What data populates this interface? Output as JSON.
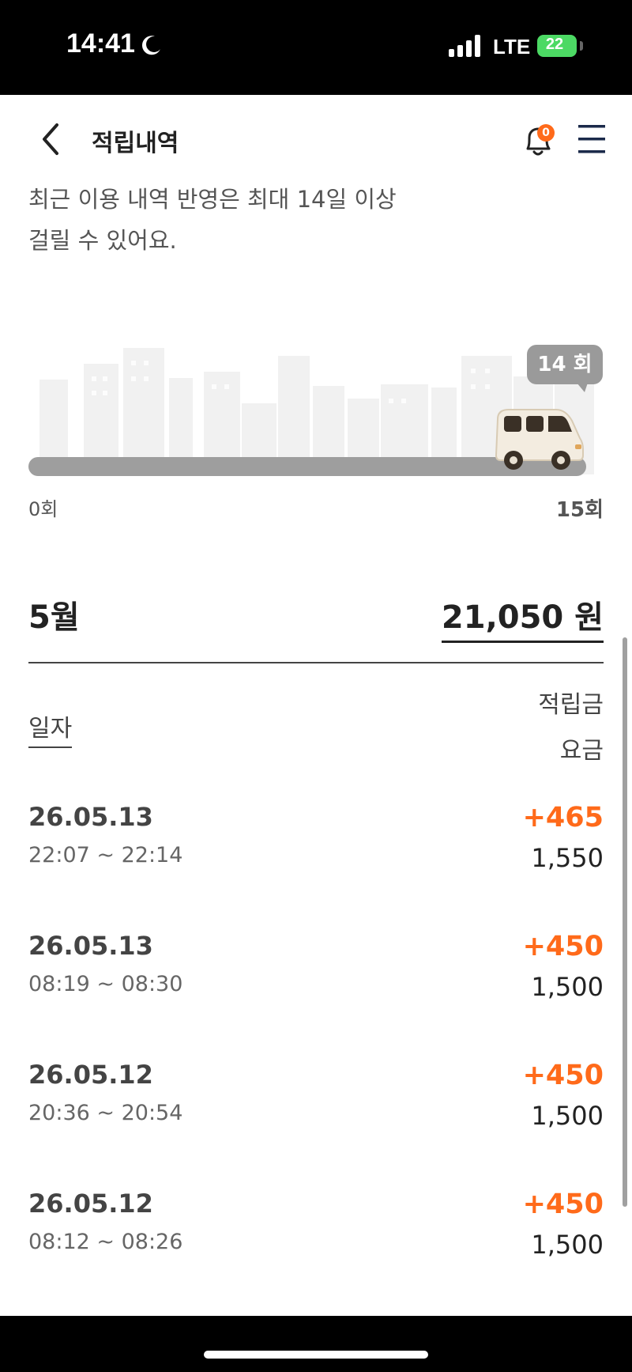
{
  "status_bar": {
    "time": "14:41",
    "network": "LTE",
    "battery": "22"
  },
  "header": {
    "title": "적립내역",
    "notification_count": "0"
  },
  "notice": {
    "line1": "최근 이용 내역 반영은 최대 14일 이상",
    "line2": "걸릴 수 있어요."
  },
  "progress": {
    "current_label": "14 회",
    "current": 14,
    "max": 15,
    "min_label": "0회",
    "max_label": "15회"
  },
  "summary": {
    "month": "5월",
    "total": "21,050 원"
  },
  "columns": {
    "date": "일자",
    "reward": "적립금",
    "fare": "요금"
  },
  "history": [
    {
      "date": "26.05.13",
      "time": "22:07 ~ 22:14",
      "reward": "+465",
      "fare": "1,550"
    },
    {
      "date": "26.05.13",
      "time": "08:19 ~ 08:30",
      "reward": "+450",
      "fare": "1,500"
    },
    {
      "date": "26.05.12",
      "time": "20:36 ~ 20:54",
      "reward": "+450",
      "fare": "1,500"
    },
    {
      "date": "26.05.12",
      "time": "08:12 ~ 08:26",
      "reward": "+450",
      "fare": "1,500"
    }
  ],
  "colors": {
    "accent": "#ff6a1a",
    "track": "#9e9e9e",
    "text": "#222222"
  },
  "icons": {
    "back": "chevron-left-icon",
    "bell": "bell-icon",
    "menu": "hamburger-menu-icon",
    "vehicle": "van-icon"
  }
}
